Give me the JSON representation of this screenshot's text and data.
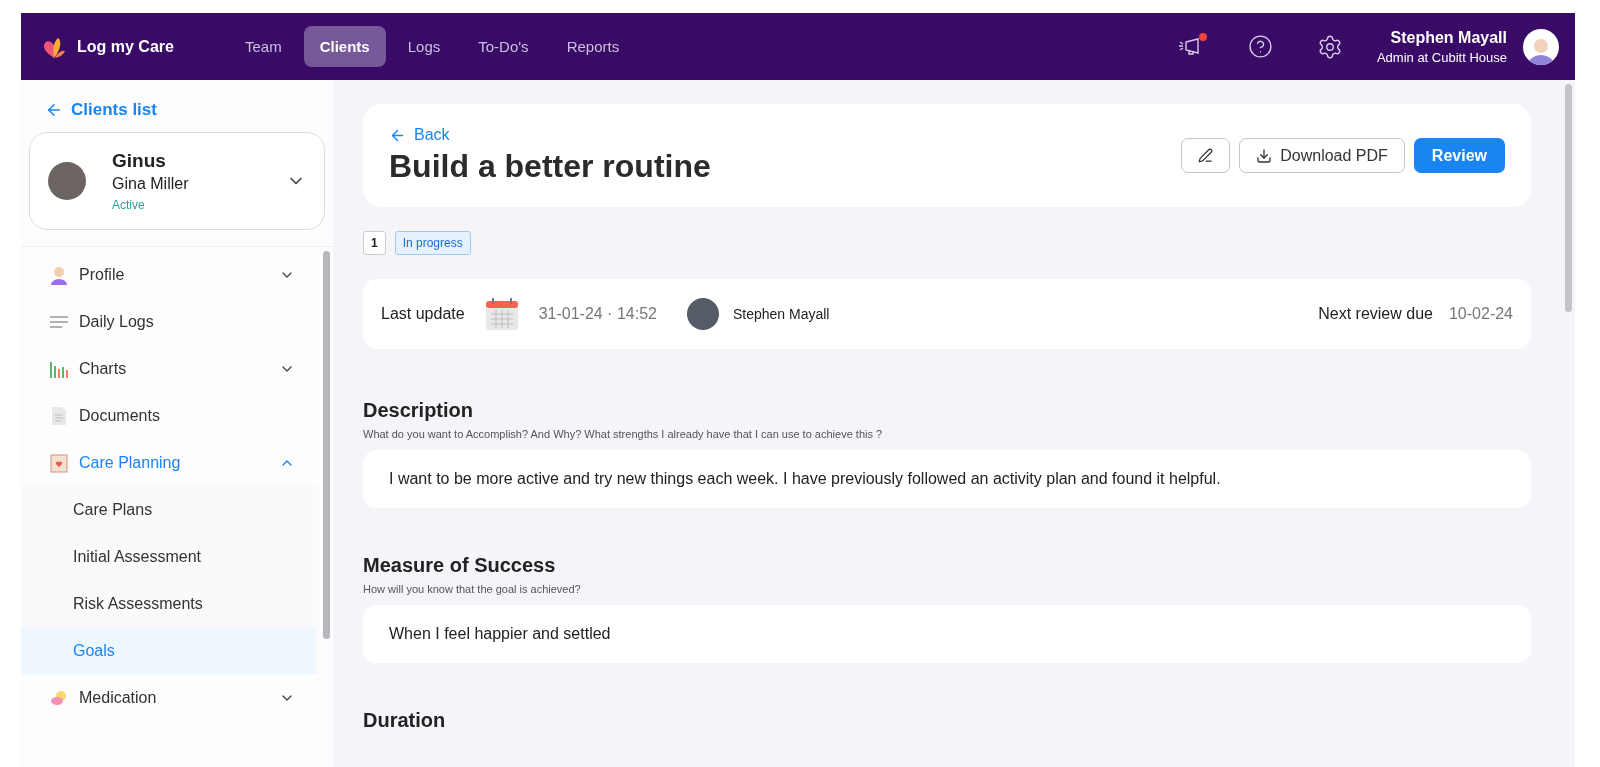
{
  "header": {
    "brand": "Log my Care",
    "nav": [
      {
        "label": "Team",
        "selected": false
      },
      {
        "label": "Clients",
        "selected": true
      },
      {
        "label": "Logs",
        "selected": false
      },
      {
        "label": "To-Do's",
        "selected": false
      },
      {
        "label": "Reports",
        "selected": false
      }
    ],
    "notification_dot": true,
    "user": {
      "name": "Stephen Mayall",
      "role": "Admin at Cubitt House"
    }
  },
  "sidebar": {
    "back_link": "Clients list",
    "client": {
      "nickname": "Ginus",
      "name": "Gina Miller",
      "status": "Active"
    },
    "items": [
      {
        "label": "Profile",
        "kind": "profile",
        "expanded": false,
        "selected": false
      },
      {
        "label": "Daily Logs",
        "kind": "logs",
        "selected": false
      },
      {
        "label": "Charts",
        "kind": "charts",
        "expanded": false,
        "selected": false
      },
      {
        "label": "Documents",
        "kind": "documents",
        "selected": false
      },
      {
        "label": "Care Planning",
        "kind": "care",
        "expanded": true,
        "selected": true,
        "children": [
          {
            "label": "Care Plans",
            "selected": false
          },
          {
            "label": "Initial Assessment",
            "selected": false
          },
          {
            "label": "Risk Assessments",
            "selected": false
          },
          {
            "label": "Goals",
            "selected": true
          }
        ]
      },
      {
        "label": "Medication",
        "kind": "medication",
        "expanded": false,
        "selected": false
      }
    ]
  },
  "goal": {
    "back_link": "Back",
    "title": "Build a better routine",
    "actions": {
      "download": "Download PDF",
      "review": "Review"
    },
    "count": "1",
    "status": "In progress",
    "last_update": {
      "label": "Last update",
      "datetime": "31-01-24 · 14:52",
      "author": "Stephen Mayall",
      "next_review_label": "Next review due",
      "next_review": "10-02-24"
    },
    "sections": [
      {
        "heading": "Description",
        "hint": "What do you want to Accomplish? And Why? What strengths I already have that I can use to achieve this ?",
        "answer": "I want to be more active and try new things each week. I have previously followed an activity plan and found it helpful."
      },
      {
        "heading": "Measure of Success",
        "hint": "How will you know that the goal is achieved?",
        "answer": "When I feel happier and settled"
      },
      {
        "heading": "Duration"
      }
    ]
  }
}
